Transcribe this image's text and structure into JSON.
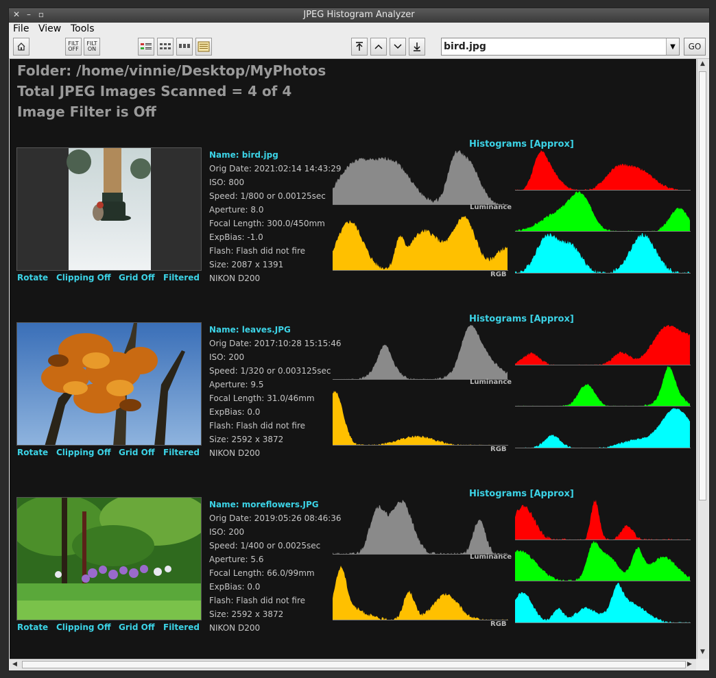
{
  "window": {
    "title": "JPEG Histogram Analyzer"
  },
  "menu": {
    "file": "File",
    "view": "View",
    "tools": "Tools"
  },
  "toolbar": {
    "filter_off": "FILT OFF",
    "filter_on": "FILT ON",
    "filename": "bird.jpg",
    "go": "GO"
  },
  "header": {
    "folder": "Folder: /home/vinnie/Desktop/MyPhotos",
    "total": "Total JPEG Images Scanned = 4 of 4",
    "filter": "Image Filter is Off"
  },
  "actions": {
    "rotate": "Rotate",
    "clipping": "Clipping Off",
    "grid": "Grid Off",
    "filtered": "Filtered"
  },
  "hist_title": "Histograms [Approx]",
  "hist_labels": {
    "luminance": "Luminance",
    "rgb": "RGB"
  },
  "colors": {
    "luminance": "#8a8a8a",
    "rgb": "#ffc000",
    "red": "#ff0000",
    "green": "#00ff00",
    "blue": "#00ffff",
    "accent": "#3cd3e6"
  },
  "images": [
    {
      "name": "Name: bird.jpg",
      "date": "Orig Date: 2021:02:14 14:43:29",
      "iso": "ISO: 800",
      "speed": "Speed: 1/800 or 0.00125sec",
      "aperture": "Aperture: 8.0",
      "focal": "Focal Length: 300.0/450mm",
      "expbias": "ExpBias: -1.0",
      "flash": "Flash: Flash did not fire",
      "size": "Size: 2087 x 1391",
      "camera": "NIKON D200"
    },
    {
      "name": "Name: leaves.JPG",
      "date": "Orig Date: 2017:10:28 15:15:46",
      "iso": "ISO: 200",
      "speed": "Speed: 1/320 or 0.003125sec",
      "aperture": "Aperture: 9.5",
      "focal": "Focal Length: 31.0/46mm",
      "expbias": "ExpBias: 0.0",
      "flash": "Flash: Flash did not fire",
      "size": "Size: 2592 x 3872",
      "camera": "NIKON D200"
    },
    {
      "name": "Name: moreflowers.JPG",
      "date": "Orig Date: 2019:05:26 08:46:36",
      "iso": "ISO: 200",
      "speed": "Speed: 1/400 or 0.0025sec",
      "aperture": "Aperture: 5.6",
      "focal": "Focal Length: 66.0/99mm",
      "expbias": "ExpBias: 0.0",
      "flash": "Flash: Flash did not fire",
      "size": "Size: 2592 x 3872",
      "camera": "NIKON D200"
    }
  ]
}
